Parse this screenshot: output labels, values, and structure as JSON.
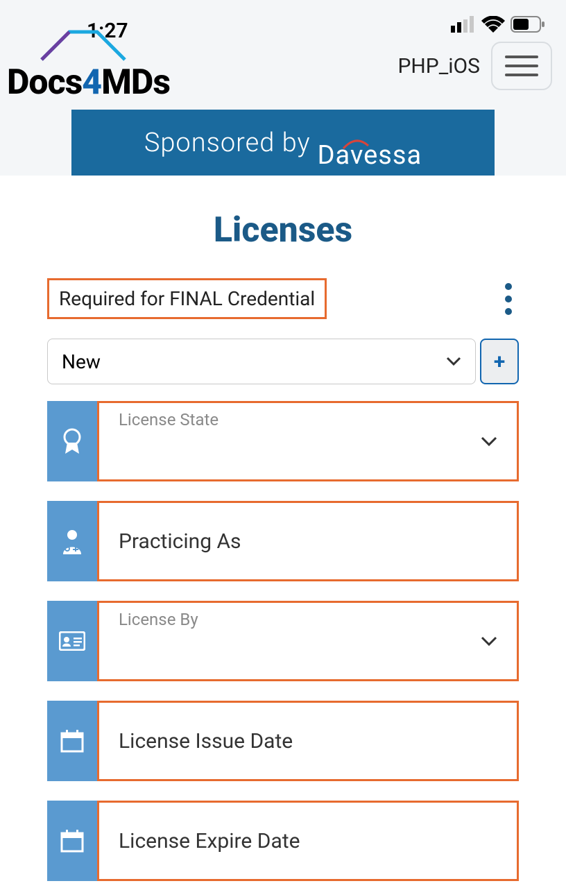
{
  "status": {
    "time": "1:27"
  },
  "header": {
    "logo_pre": "Docs",
    "logo_mid": "4",
    "logo_post": "MDs",
    "label": "PHP_iOS"
  },
  "sponsor": {
    "text": "Sponsored by",
    "brand": "Davessa"
  },
  "page_title": "Licenses",
  "required_badge": "Required for FINAL Credential",
  "new_select": {
    "value": "New"
  },
  "fields": [
    {
      "label": "License State",
      "type": "select_small"
    },
    {
      "label": "Practicing As",
      "type": "text"
    },
    {
      "label": "License By",
      "type": "select_small"
    },
    {
      "label": "License Issue Date",
      "type": "date"
    },
    {
      "label": "License Expire Date",
      "type": "date"
    }
  ]
}
